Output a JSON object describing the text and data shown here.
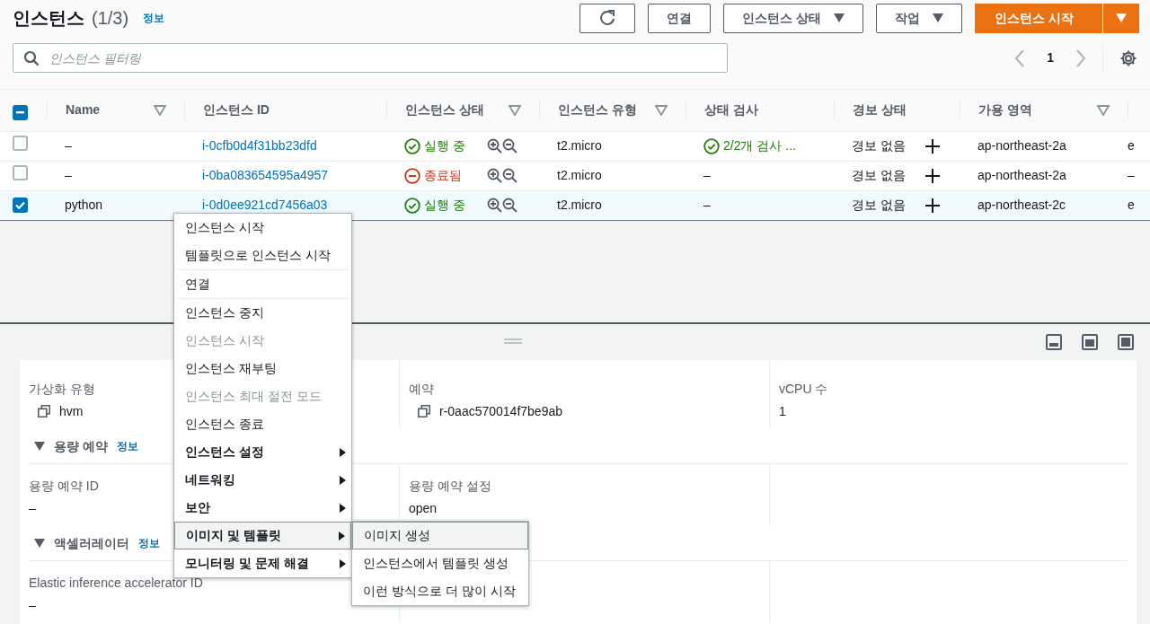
{
  "header": {
    "title": "인스턴스",
    "count": "(1/3)",
    "info_link": "정보"
  },
  "toolbar": {
    "buttons": [
      {
        "kind": "refresh"
      },
      {
        "kind": "plain",
        "label": "연결"
      },
      {
        "kind": "dropdown",
        "label": "인스턴스 상태"
      },
      {
        "kind": "dropdown",
        "label": "작업"
      },
      {
        "kind": "split",
        "label": "인스턴스 시작"
      }
    ]
  },
  "filter": {
    "placeholder": "인스턴스 필터링"
  },
  "pagination": {
    "page": "1"
  },
  "table": {
    "header_checkbox": {
      "indeterminate": true
    },
    "columns": [
      {
        "label": "Name",
        "sortable": true
      },
      {
        "label": "인스턴스 ID",
        "sortable": false
      },
      {
        "label": "인스턴스 상태",
        "sortable": true
      },
      {
        "label": "인스턴스 유형",
        "sortable": true
      },
      {
        "label": "상태 검사",
        "sortable": false
      },
      {
        "label": "경보 상태",
        "sortable": false
      },
      {
        "label": "가용 영역",
        "sortable": true
      }
    ],
    "rows": [
      {
        "selected": false,
        "name": "–",
        "instance_id": "i-0cfb0d4f31bb23dfd",
        "state": {
          "kind": "running",
          "label": "실행 중"
        },
        "type": "t2.micro",
        "status_check": {
          "kind": "passed",
          "label": "2/2개 검사 ..."
        },
        "alarm": "경보 없음",
        "zone": "ap-northeast-2a",
        "column_9": "e"
      },
      {
        "selected": false,
        "name": "–",
        "instance_id": "i-0ba083654595a4957",
        "state": {
          "kind": "terminated",
          "label": "종료됨"
        },
        "type": "t2.micro",
        "status_check": {
          "kind": "none",
          "label": "–"
        },
        "alarm": "경보 없음",
        "zone": "ap-northeast-2a",
        "column_9": "–"
      },
      {
        "selected": true,
        "name": "python",
        "instance_id": "i-0d0ee921cd7456a03",
        "state": {
          "kind": "running",
          "label": "실행 중"
        },
        "type": "t2.micro",
        "status_check": {
          "kind": "none",
          "label": "–"
        },
        "alarm": "경보 없음",
        "zone": "ap-northeast-2c",
        "column_9": "e"
      }
    ]
  },
  "details": {
    "groups": [
      {
        "fields": [
          {
            "label": "가상화 유형",
            "value": "hvm",
            "copyable": true
          },
          {
            "label": "예약",
            "value": "r-0aac570014f7be9ab",
            "copyable": true
          },
          {
            "label": "vCPU 수",
            "value": "1",
            "copyable": false
          }
        ]
      },
      {
        "title": "용량 예약",
        "info_link": "정보",
        "fields": [
          {
            "label": "용량 예약 ID",
            "value": "–",
            "copyable": false
          },
          {
            "label": "용량 예약 설정",
            "value": "open",
            "copyable": false
          }
        ]
      },
      {
        "title": "액셀러레이터",
        "info_link": "정보",
        "fields": [
          {
            "label": "Elastic inference accelerator ID",
            "value": "–",
            "copyable": false
          }
        ]
      }
    ]
  },
  "context_menu": {
    "groups": [
      [
        {
          "label": "인스턴스 시작",
          "disabled": false,
          "has_submenu": false,
          "selected": false
        },
        {
          "label": "템플릿으로 인스턴스 시작",
          "disabled": false,
          "has_submenu": false,
          "selected": false
        }
      ],
      [
        {
          "label": "연결",
          "disabled": false,
          "has_submenu": false,
          "selected": false
        }
      ],
      [
        {
          "label": "인스턴스 중지",
          "disabled": false,
          "has_submenu": false,
          "selected": false
        },
        {
          "label": "인스턴스 시작",
          "disabled": true,
          "has_submenu": false,
          "selected": false
        },
        {
          "label": "인스턴스 재부팅",
          "disabled": false,
          "has_submenu": false,
          "selected": false
        },
        {
          "label": "인스턴스 최대 절전 모드",
          "disabled": true,
          "has_submenu": false,
          "selected": false
        },
        {
          "label": "인스턴스 종료",
          "disabled": false,
          "has_submenu": false,
          "selected": false
        },
        {
          "label": "인스턴스 설정",
          "disabled": false,
          "has_submenu": true,
          "selected": false
        },
        {
          "label": "네트워킹",
          "disabled": false,
          "has_submenu": true,
          "selected": false
        },
        {
          "label": "보안",
          "disabled": false,
          "has_submenu": true,
          "selected": false
        },
        {
          "label": "이미지 및 템플릿",
          "disabled": false,
          "has_submenu": true,
          "selected": true
        },
        {
          "label": "모니터링 및 문제 해결",
          "disabled": false,
          "has_submenu": true,
          "selected": false
        }
      ]
    ]
  },
  "submenu": {
    "items": [
      {
        "label": "이미지 생성",
        "selected": true
      },
      {
        "label": "인스턴스에서 템플릿 생성",
        "selected": false
      },
      {
        "label": "이런 방식으로 더 많이 시작",
        "selected": false
      }
    ]
  }
}
